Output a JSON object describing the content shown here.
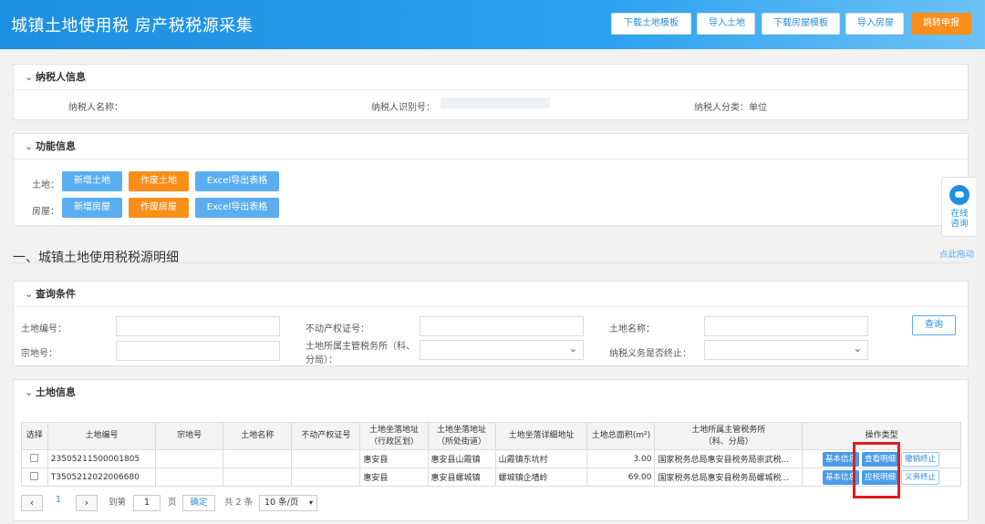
{
  "header": {
    "title": "城镇土地使用税 房产税税源采集",
    "buttons": [
      "下载土地模板",
      "导入土地",
      "下载房屋模板",
      "导入房屋",
      "跳转申报"
    ]
  },
  "taxpayer": {
    "section": "纳税人信息",
    "name_label": "纳税人名称：",
    "id_label": "纳税人识别号：",
    "category_label": "纳税人分类：单位"
  },
  "functions": {
    "section": "功能信息",
    "land_label": "土地：",
    "house_label": "房屋：",
    "land_buttons": [
      "新增土地",
      "作废土地",
      "Excel导出表格"
    ],
    "house_buttons": [
      "新增房屋",
      "作废房屋",
      "Excel导出表格"
    ]
  },
  "detail_title": "一、城镇土地使用税税源明细",
  "query": {
    "section": "查询条件",
    "land_no": "土地编号：",
    "property_cert": "不动产权证号：",
    "land_name": "土地名称：",
    "parcel_no": "宗地号：",
    "tax_office_1": "土地所属主管税务所（科、",
    "tax_office_2": "分局）：",
    "terminated": "纳税义务是否终止：",
    "query_button": "查询"
  },
  "land_info": {
    "section": "土地信息",
    "columns": [
      "选择",
      "土地编号",
      "宗地号",
      "土地名称",
      "不动产权证号",
      "土地坐落地址（行政区划）",
      "土地坐落地址（所处街道）",
      "土地坐落详细地址",
      "土地总面积(m²)",
      "土地所属主管税务所（科、分局）",
      "操作类型"
    ],
    "col_addr1_a": "土地坐落地址",
    "col_addr1_b": "（行政区划）",
    "col_addr2_a": "土地坐落地址",
    "col_addr2_b": "（所处街道）",
    "col_office_a": "土地所属主管税务所",
    "col_office_b": "（科、分局）",
    "rows": [
      {
        "no": "23505211500001805",
        "parcel": "",
        "name": "",
        "cert": "",
        "district": "惠安县",
        "street": "惠安县山霞镇",
        "detail": "山霞镇东坑村",
        "area": "3.00",
        "office": "国家税务总局惠安县税务局崇武税...",
        "op1": "基本信息",
        "op2": "查看明细",
        "op3": "撤销终止"
      },
      {
        "no": "T3505212022006680",
        "parcel": "",
        "name": "",
        "cert": "",
        "district": "惠安县",
        "street": "惠安县螺城镇",
        "detail": "螺城镇企墙岭",
        "area": "69.00",
        "office": "国家税务总局惠安县税务局螺城税...",
        "op1": "基本信息",
        "op2": "应税明细",
        "op3": "义务终止"
      }
    ]
  },
  "pagination": {
    "current": "1",
    "goto_label": "到第",
    "goto_value": "1",
    "page_unit": "页",
    "confirm": "确定",
    "total": "共 2 条",
    "page_size": "10 条/页"
  },
  "float": {
    "consult": "在线咨询",
    "consult_1": "在线",
    "consult_2": "咨询",
    "drag": "点此拖动"
  }
}
